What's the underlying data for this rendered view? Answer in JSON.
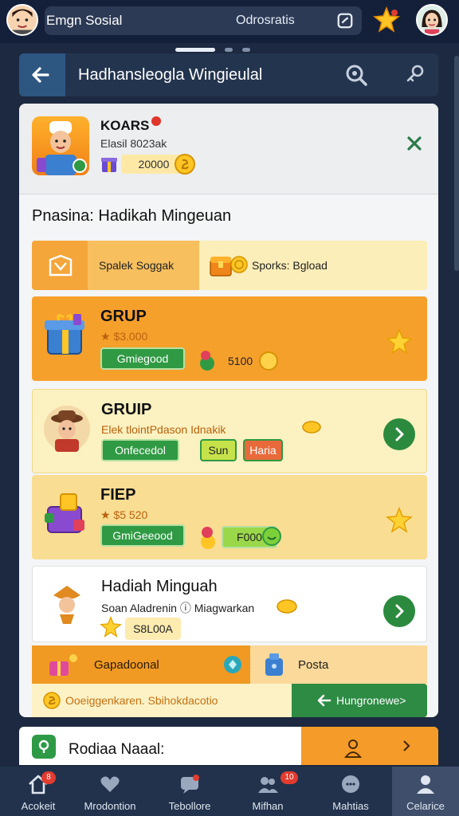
{
  "topbar": {
    "app_name": "Emgn Sosial",
    "status_text": "Odrosratis"
  },
  "header": {
    "title": "Hadhansleogla Wingieulal"
  },
  "profile": {
    "name": "KOARS",
    "subtitle": "Elasil 8023ak",
    "coins": "20000"
  },
  "section": {
    "title": "Pnasina: Hadikah Mingeuan"
  },
  "tabs": [
    {
      "label": "Spalek Soggak"
    },
    {
      "label": "Sporks: Bgload"
    }
  ],
  "cards": [
    {
      "title": "GRUP",
      "subtitle": "★ $3.000",
      "button": "Gmiegood",
      "chip": "5100"
    },
    {
      "title": "GRUIP",
      "subtitle": "Elek tlointPdason Idnakik",
      "button": "Onfecedol",
      "chip1": "Sun",
      "chip2": "Haria"
    },
    {
      "title": "FIEP",
      "subtitle": "★ $5 520",
      "button": "GmiGeeood",
      "chip": "F000"
    },
    {
      "title": "Hadiah Minguah",
      "subtitle": "Soan Aladrenin ⓘ Miagwarkan",
      "chip": "S8L00A"
    }
  ],
  "bottom_strip": {
    "left_label": "Gapadoonal",
    "right_label": "Posta"
  },
  "footer_strip": {
    "text": "Ooeiggenkaren. Sbihokdacotio",
    "button": "Hungronewe>"
  },
  "lower": {
    "title": "Rodiaa Naaal:"
  },
  "nav": [
    {
      "label": "Acokeit",
      "badge": "8"
    },
    {
      "label": "Mrodontion",
      "badge": ""
    },
    {
      "label": "Tebollore",
      "badge": ""
    },
    {
      "label": "Mifhan",
      "badge": "10"
    },
    {
      "label": "Mahtias",
      "badge": ""
    },
    {
      "label": "Celarice",
      "badge": ""
    }
  ],
  "colors": {
    "accent_orange": "#f6a02c",
    "accent_green": "#2f9a43",
    "navy": "#1c2940"
  },
  "icons": [
    "user-avatar",
    "stats-icon",
    "star-icon",
    "back-arrow-icon",
    "search-icon",
    "key-icon",
    "close-icon",
    "gift-icon",
    "chevron-right-icon",
    "coin-icon",
    "home-icon",
    "heart-icon",
    "group-icon",
    "chat-icon",
    "profile-icon"
  ]
}
